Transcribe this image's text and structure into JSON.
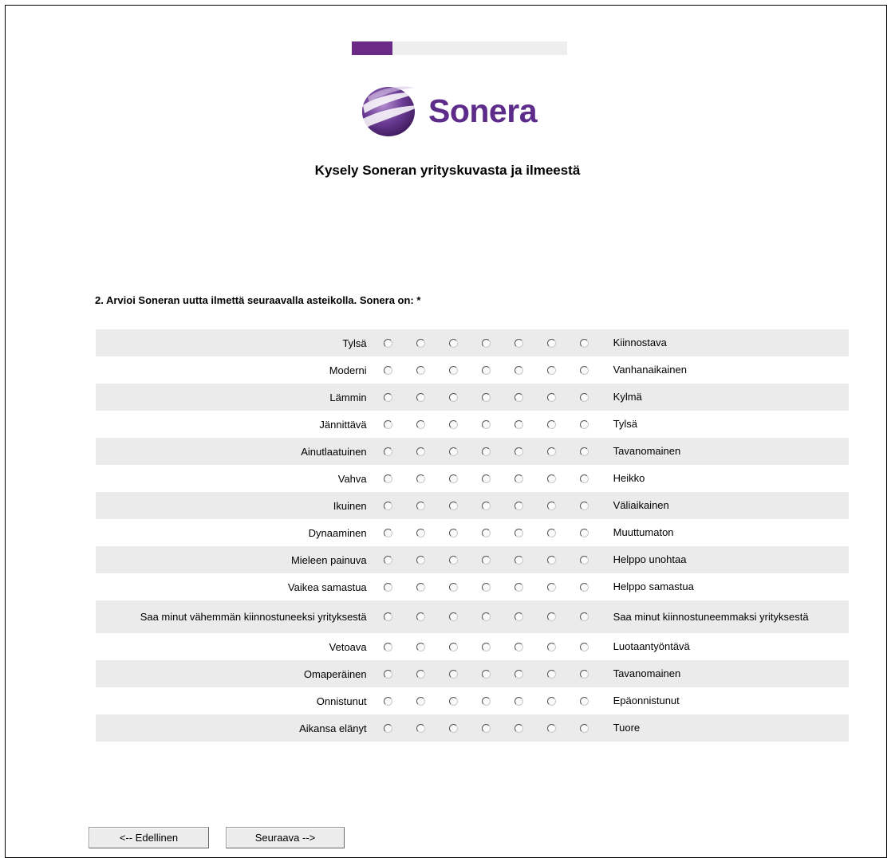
{
  "progress": {
    "fraction": 0.19,
    "color": "#6b2a86",
    "track": "#eeeeee"
  },
  "brand": {
    "name": "Sonera",
    "color": "#5d2b8a",
    "logo_icon": "sonera-sphere-logo"
  },
  "survey_title": "Kysely Soneran yrityskuvasta ja ilmeestä",
  "question": "2. Arvioi Soneran uutta ilmettä seuraavalla asteikolla. Sonera on: *",
  "scale_points": 7,
  "rows": [
    {
      "left": "Tylsä",
      "right": "Kiinnostava"
    },
    {
      "left": "Moderni",
      "right": "Vanhanaikainen"
    },
    {
      "left": "Lämmin",
      "right": "Kylmä"
    },
    {
      "left": "Jännittävä",
      "right": "Tylsä"
    },
    {
      "left": "Ainutlaatuinen",
      "right": "Tavanomainen"
    },
    {
      "left": "Vahva",
      "right": "Heikko"
    },
    {
      "left": "Ikuinen",
      "right": "Väliaikainen"
    },
    {
      "left": "Dynaaminen",
      "right": "Muuttumaton"
    },
    {
      "left": "Mieleen painuva",
      "right": "Helppo unohtaa"
    },
    {
      "left": "Vaikea samastua",
      "right": "Helppo samastua"
    },
    {
      "left": "Saa minut vähemmän kiinnostuneeksi yrityksestä",
      "right": "Saa minut kiinnostuneemmaksi yrityksestä"
    },
    {
      "left": "Vetoava",
      "right": "Luotaantyöntävä"
    },
    {
      "left": "Omaperäinen",
      "right": "Tavanomainen"
    },
    {
      "left": "Onnistunut",
      "right": "Epäonnistunut"
    },
    {
      "left": "Aikansa elänyt",
      "right": "Tuore"
    }
  ],
  "buttons": {
    "prev": "<-- Edellinen",
    "next": "Seuraava -->"
  },
  "colors": {
    "row_shade": "#ebebeb"
  }
}
